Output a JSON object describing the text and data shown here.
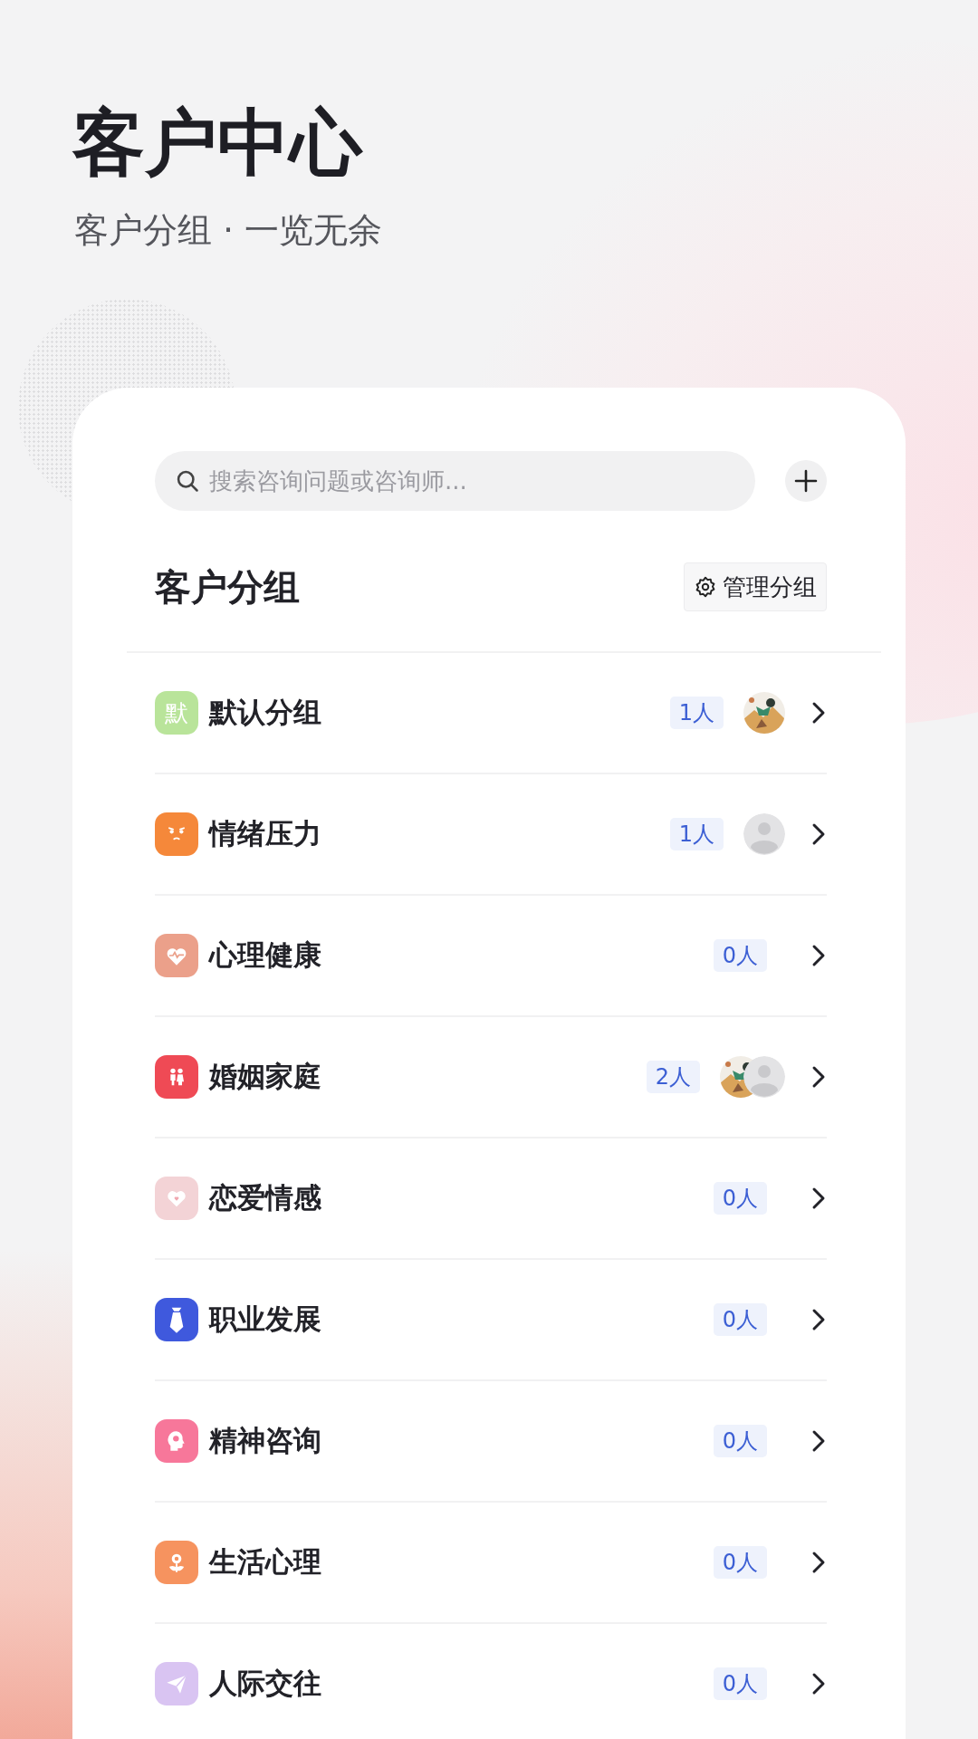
{
  "header": {
    "title": "客户中心",
    "subtitle": "客户分组 · 一览无余"
  },
  "search": {
    "placeholder": "搜索咨询问题或咨询师..."
  },
  "section": {
    "title": "客户分组",
    "manage_button": "管理分组"
  },
  "groups": [
    {
      "name": "默认分组",
      "kind": "initial",
      "icon_text": "默",
      "color": "#b9e49a",
      "count": "1人",
      "avatars": [
        {
          "kind": "picture"
        }
      ]
    },
    {
      "name": "情绪压力",
      "kind": "face",
      "color": "#f5883a",
      "count": "1人",
      "avatars": [
        {
          "kind": "silhouette"
        }
      ]
    },
    {
      "name": "心理健康",
      "kind": "pulse",
      "color": "#eba08a",
      "count": "0人"
    },
    {
      "name": "婚姻家庭",
      "kind": "couple",
      "color": "#ef4a55",
      "count": "2人",
      "avatars": [
        {
          "kind": "picture"
        },
        {
          "kind": "silhouette"
        }
      ]
    },
    {
      "name": "恋爱情感",
      "kind": "heart",
      "color": "#f3d3d6",
      "count": "0人"
    },
    {
      "name": "职业发展",
      "kind": "tie",
      "color": "#3f59dd",
      "count": "0人"
    },
    {
      "name": "精神咨询",
      "kind": "head",
      "color": "#f7779a",
      "count": "0人"
    },
    {
      "name": "生活心理",
      "kind": "flower",
      "color": "#f6935f",
      "count": "0人"
    },
    {
      "name": "人际交往",
      "kind": "plane",
      "color": "#d9c4f2",
      "count": "0人"
    }
  ]
}
